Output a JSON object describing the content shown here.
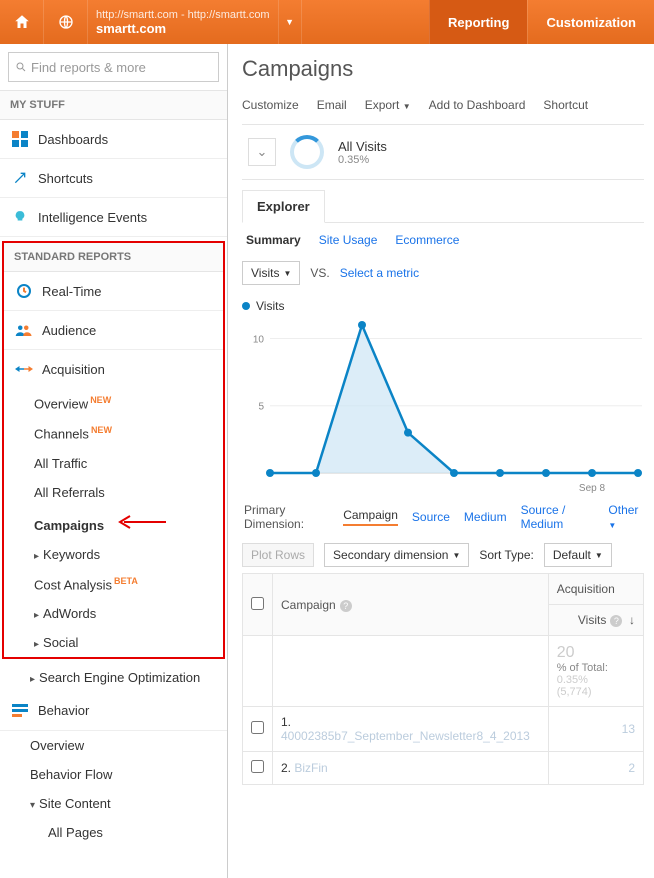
{
  "topbar": {
    "url": "http://smartt.com - http://smartt.com",
    "name": "smartt.com",
    "reporting": "Reporting",
    "customization": "Customization"
  },
  "search": {
    "placeholder": "Find reports & more"
  },
  "sections": {
    "mystuff": "MY STUFF",
    "standard": "STANDARD REPORTS"
  },
  "nav": {
    "dashboards": "Dashboards",
    "shortcuts": "Shortcuts",
    "intel": "Intelligence Events",
    "realtime": "Real-Time",
    "audience": "Audience",
    "acquisition": "Acquisition",
    "acq_items": {
      "overview": "Overview",
      "channels": "Channels",
      "alltraffic": "All Traffic",
      "allreferrals": "All Referrals",
      "campaigns": "Campaigns",
      "keywords": "Keywords",
      "cost": "Cost Analysis",
      "adwords": "AdWords",
      "social": "Social",
      "seo": "Search Engine Optimization"
    },
    "badges": {
      "new": "NEW",
      "beta": "BETA"
    },
    "behavior": "Behavior",
    "beh_items": {
      "overview": "Overview",
      "flow": "Behavior Flow",
      "sitecontent": "Site Content",
      "allpages": "All Pages"
    }
  },
  "page": {
    "title": "Campaigns",
    "toolbar": {
      "customize": "Customize",
      "email": "Email",
      "export": "Export",
      "dash": "Add to Dashboard",
      "shortcut": "Shortcut"
    },
    "segment": {
      "label": "All Visits",
      "pct": "0.35%"
    },
    "tabs": {
      "explorer": "Explorer"
    },
    "subtabs": {
      "summary": "Summary",
      "siteusage": "Site Usage",
      "ecommerce": "Ecommerce"
    },
    "metric": {
      "visits": "Visits",
      "vs": "VS.",
      "select": "Select a metric"
    },
    "legend": {
      "visits": "Visits"
    },
    "dim": {
      "label": "Primary Dimension:",
      "campaign": "Campaign",
      "source": "Source",
      "medium": "Medium",
      "sourcemedium": "Source / Medium",
      "other": "Other"
    },
    "ctrl": {
      "plotrows": "Plot Rows",
      "secondary": "Secondary dimension",
      "sorttype": "Sort Type:",
      "default": "Default"
    },
    "table": {
      "campaign_h": "Campaign",
      "acq_h": "Acquisition",
      "visits_h": "Visits",
      "total_label": "% of Total:",
      "total_val": "20",
      "total_pct": "0.35%",
      "total_paren": "(5,774)",
      "rows": [
        {
          "n": "1.",
          "name": "40002385b7_September_Newsletter8_4_2013",
          "visits": "13"
        },
        {
          "n": "2.",
          "name": "BizFin",
          "visits": "2"
        }
      ]
    }
  },
  "chart_data": {
    "type": "area",
    "x": [
      "Sep 1",
      "Sep 2",
      "Sep 3",
      "Sep 4",
      "Sep 5",
      "Sep 6",
      "Sep 7",
      "Sep 8",
      "Sep 9"
    ],
    "values": [
      0,
      0,
      11,
      3,
      0,
      0,
      0,
      0,
      0
    ],
    "ylabel": "Visits",
    "ylim": [
      0,
      10
    ],
    "yticks": [
      5,
      10
    ],
    "xlabel_shown": "Sep 8",
    "series_name": "Visits",
    "color": "#0b84c6"
  }
}
